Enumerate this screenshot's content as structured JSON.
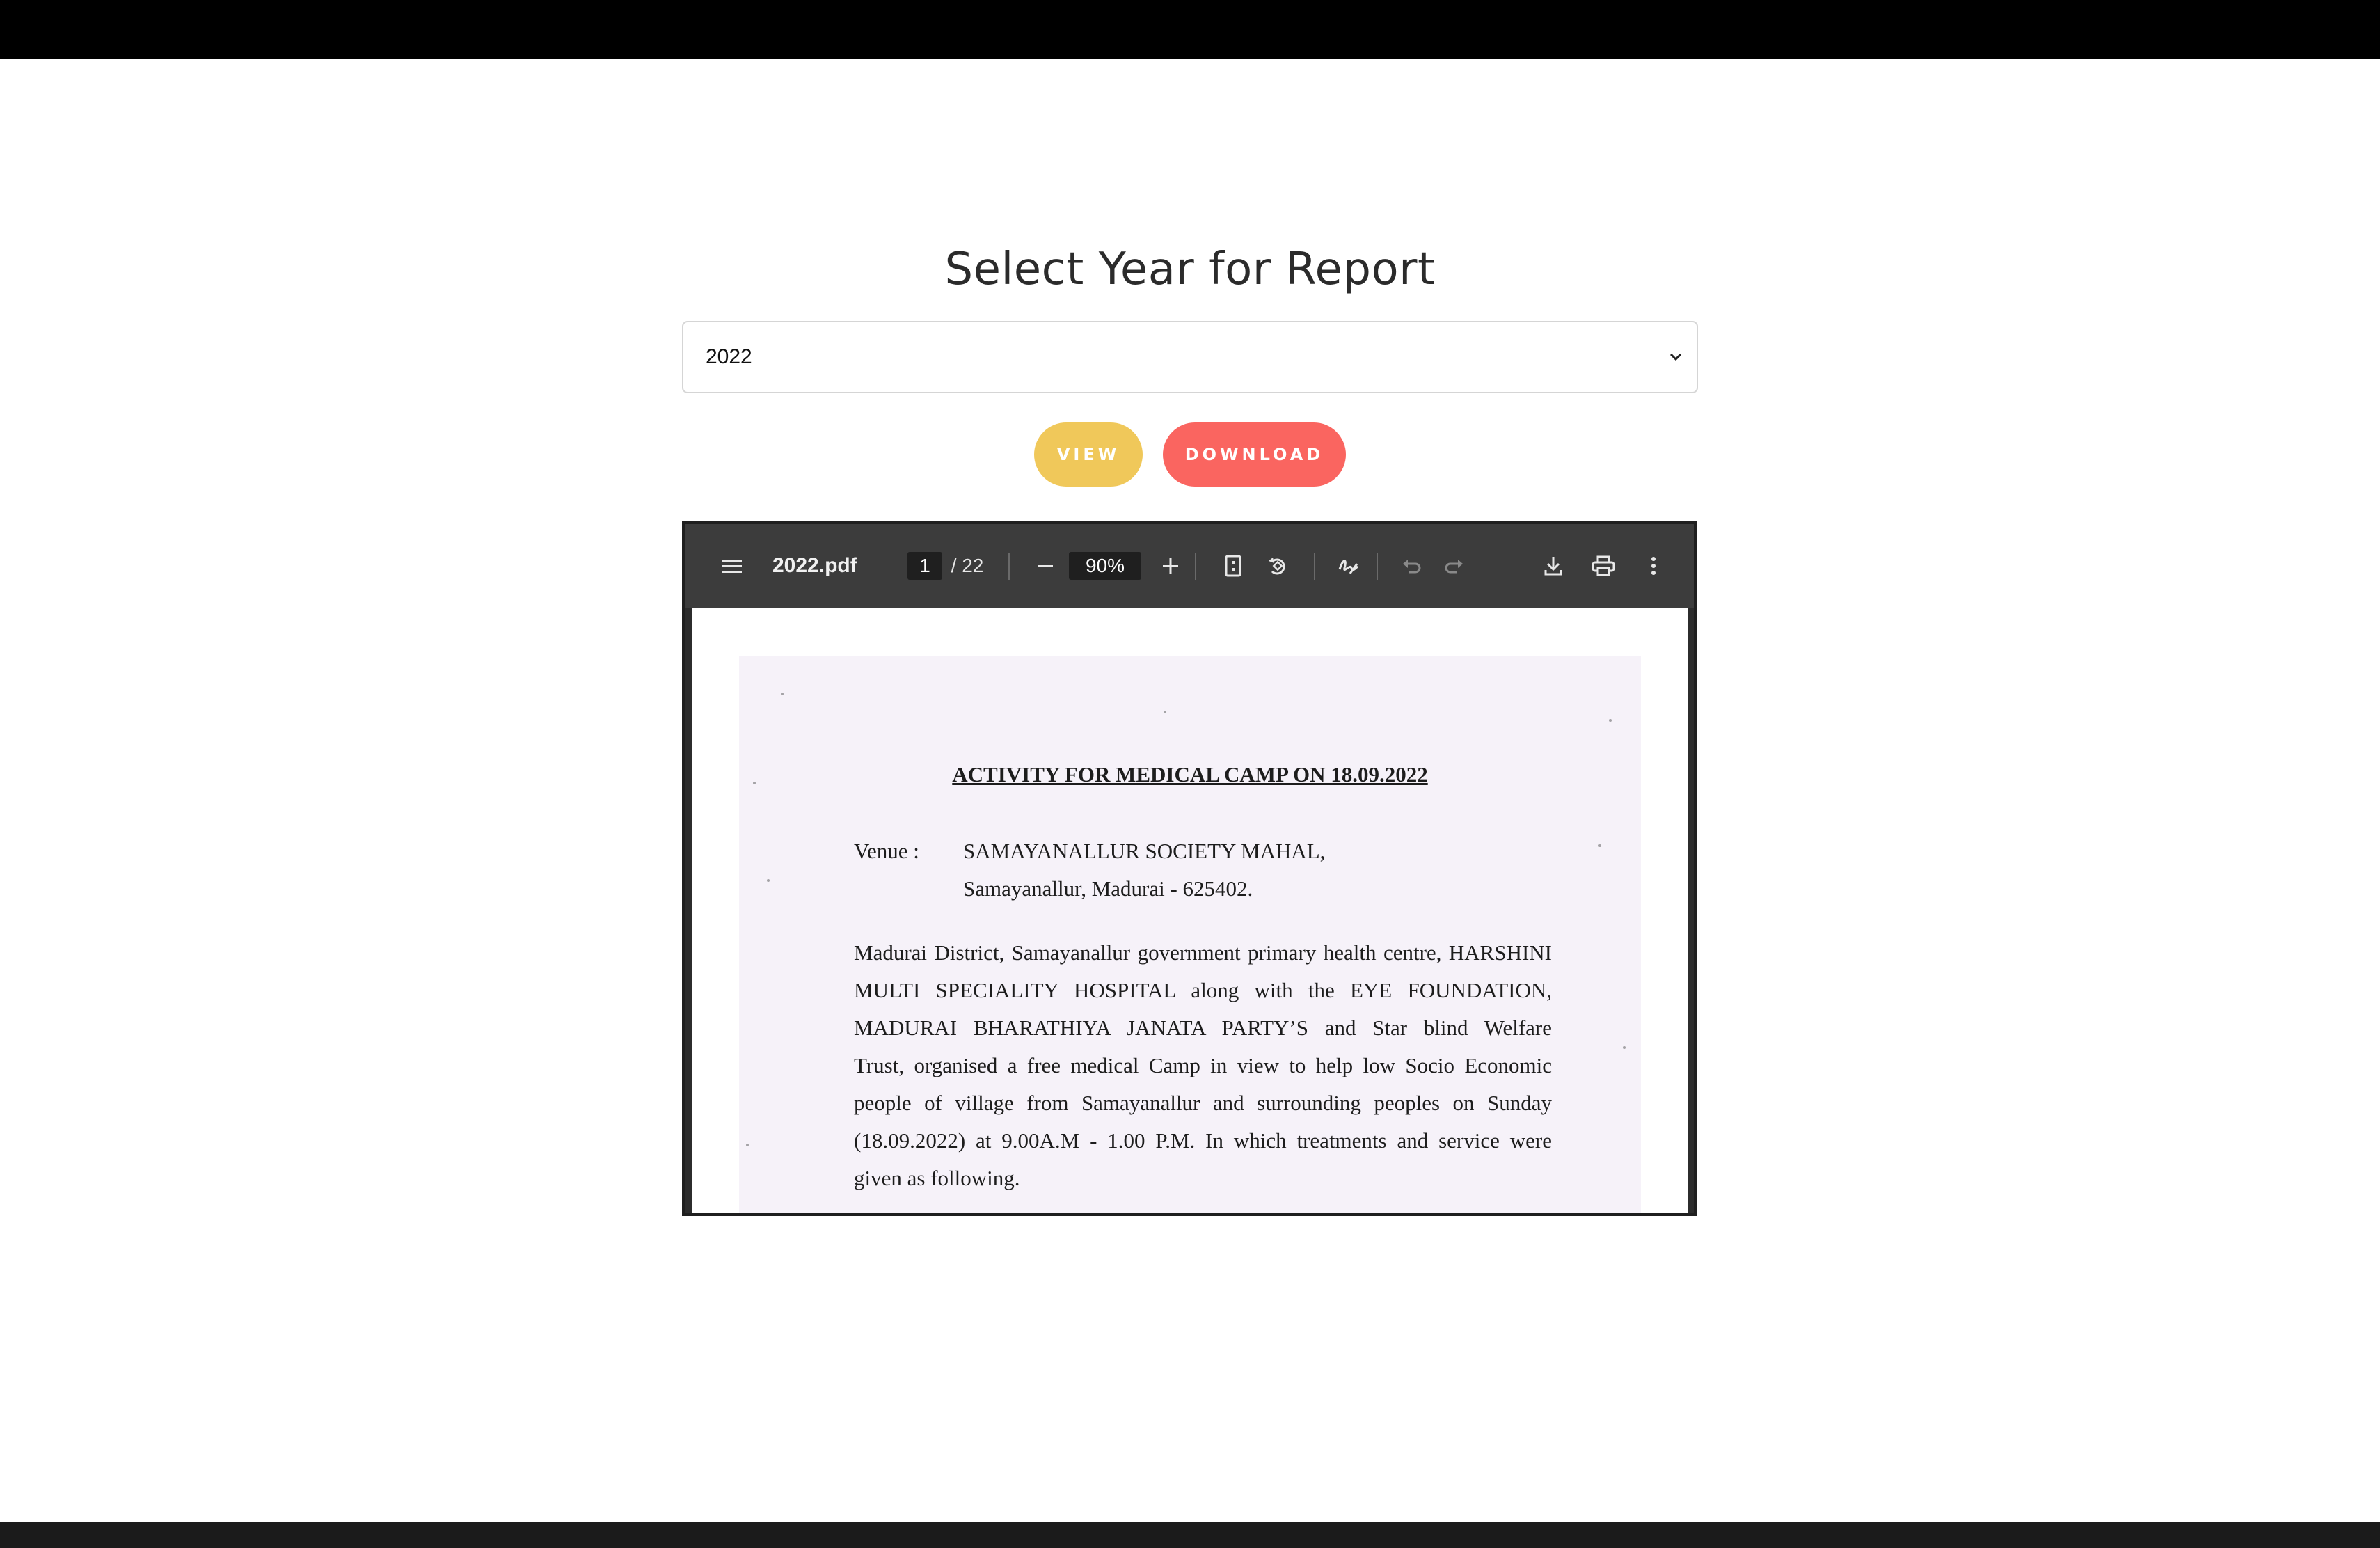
{
  "page": {
    "title": "Select Year for Report"
  },
  "year_select": {
    "value": "2022"
  },
  "buttons": {
    "view": "VIEW",
    "download": "DOWNLOAD"
  },
  "pdf_viewer": {
    "filename": "2022.pdf",
    "current_page": "1",
    "total_pages": "/ 22",
    "zoom": "90%",
    "icons": [
      "menu-icon",
      "zoom-out-icon",
      "zoom-in-icon",
      "fit-page-icon",
      "rotate-icon",
      "annotate-icon",
      "undo-icon",
      "redo-icon",
      "download-icon",
      "print-icon",
      "more-options-icon"
    ]
  },
  "document": {
    "heading": "ACTIVITY FOR MEDICAL CAMP ON 18.09.2022",
    "venue_label": "Venue :",
    "venue_line1": "SAMAYANALLUR SOCIETY MAHAL,",
    "venue_line2": "Samayanallur, Madurai - 625402.",
    "paragraph_lines": [
      "Madurai District, Samayanallur government primary health centre, HARSHINI",
      "MULTI SPECIALITY HOSPITAL along with the EYE FOUNDATION,",
      "MADURAI BHARATHIYA JANATA PARTY’S   and Star blind Welfare",
      "Trust, organised a free medical Camp in view to help low Socio Economic",
      "people of village from Samayanallur and surrounding peoples on Sunday",
      "(18.09.2022) at 9.00A.M - 1.00 P.M. In which treatments and service were",
      "given as following."
    ]
  },
  "colors": {
    "view_button": "#f0c85a",
    "download_button": "#fa6560",
    "viewer_toolbar": "#3c3c3c"
  }
}
